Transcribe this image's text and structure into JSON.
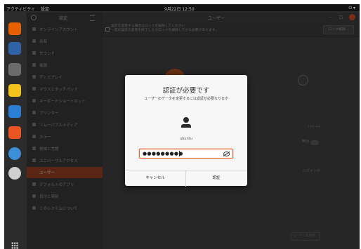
{
  "topbar": {
    "activities": "アクティビティ",
    "app": "設定",
    "clock": "9月22日 12:50",
    "tray": ""
  },
  "dock": {
    "items": [
      {
        "name": "firefox-icon",
        "color": "#e66000"
      },
      {
        "name": "thunderbird-icon",
        "color": "#2f63a7"
      },
      {
        "name": "files-icon",
        "color": "#6b6b6b"
      },
      {
        "name": "rhythmbox-icon",
        "color": "#f3c21d"
      },
      {
        "name": "writer-icon",
        "color": "#2a7fd4"
      },
      {
        "name": "software-icon",
        "color": "#e95420"
      },
      {
        "name": "help-icon",
        "color": "#3b8fd6"
      },
      {
        "name": "disc-icon",
        "color": "#cfcfcf"
      }
    ]
  },
  "window": {
    "sidebar_title": "設定",
    "main_title": "ユーザー",
    "controls": {
      "minimize": "–",
      "maximize": "□"
    }
  },
  "sidebar": {
    "items": [
      {
        "label": "オンラインアカウント",
        "active": false
      },
      {
        "label": "共有",
        "active": false
      },
      {
        "label": "サウンド",
        "active": false
      },
      {
        "label": "電源",
        "active": false
      },
      {
        "label": "ディスプレイ",
        "active": false
      },
      {
        "label": "マウスとタッチパッド",
        "active": false
      },
      {
        "label": "キーボードショートカット",
        "active": false
      },
      {
        "label": "プリンター",
        "active": false
      },
      {
        "label": "リムーバブルメディア",
        "active": false
      },
      {
        "label": "カラー",
        "active": false
      },
      {
        "label": "地域と言語",
        "active": false
      },
      {
        "label": "ユニバーサルアクセス",
        "active": false
      },
      {
        "label": "ユーザー",
        "active": true
      },
      {
        "label": "デフォルトのアプリ",
        "active": false
      },
      {
        "label": "日付と時刻",
        "active": false
      },
      {
        "label": "このシステムについて",
        "active": false
      }
    ]
  },
  "main": {
    "lock_text": "設定を変更する場合はロックを解除してください\n一度の設定の変更を終了したらロックを解除してから必要があります。",
    "unlock_button": "ロック解除...",
    "user_name": "ubuntu",
    "row_values": [
      "••••••",
      "無効",
      "ログイン中"
    ],
    "remove_button": "ユーザーを削除..."
  },
  "auth_dialog": {
    "title": "認証が必要です",
    "message": "ユーザーのデータを変更するには認証が必要なります",
    "username": "ubuntu",
    "password_dots": "●●●●●●●●●",
    "cancel_label": "キャンセル",
    "authenticate_label": "認証"
  },
  "colors": {
    "accent": "#e9622f",
    "sidebar_active": "#8a3a1d",
    "avatar": "#a24a1f"
  }
}
